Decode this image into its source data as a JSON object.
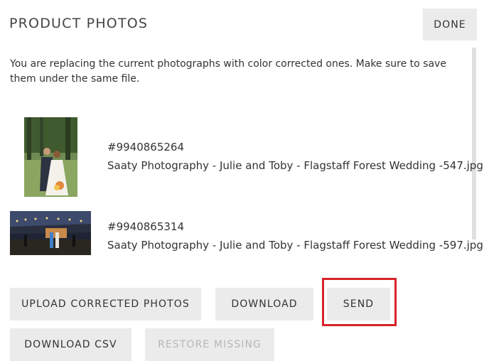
{
  "dialog": {
    "title": "PRODUCT PHOTOS",
    "done_label": "DONE",
    "notice": "You are replacing the current photographs with color corrected ones. Make sure to save them under the same file."
  },
  "photos": [
    {
      "id": "#9940865264",
      "filename": "Saaty Photography - Julie and Toby - Flagstaff Forest Wedding -547.jpg",
      "thumbnail": "wedding-couple-forest-portrait"
    },
    {
      "id": "#9940865314",
      "filename": "Saaty Photography - Julie and Toby - Flagstaff Forest Wedding -597.jpg",
      "thumbnail": "wedding-reception-night-landscape"
    }
  ],
  "actions": {
    "upload_label": "UPLOAD CORRECTED PHOTOS",
    "download_label": "DOWNLOAD",
    "send_label": "SEND",
    "download_csv_label": "DOWNLOAD CSV",
    "restore_missing_label": "RESTORE MISSING",
    "restore_missing_disabled": true
  },
  "colors": {
    "button_bg": "#ebebeb",
    "text": "#333333",
    "disabled_text": "#b7b7b7",
    "highlight": "#d8232a"
  }
}
